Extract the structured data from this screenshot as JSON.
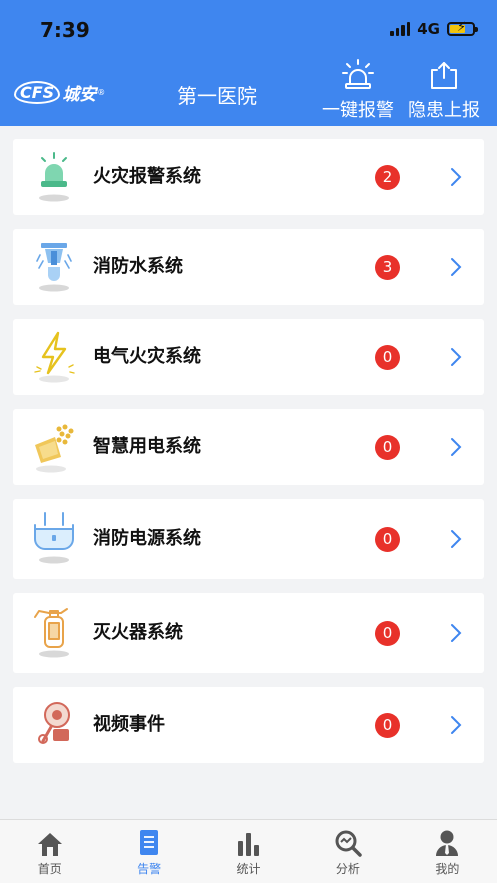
{
  "status_bar": {
    "time": "7:39",
    "network": "4G"
  },
  "header": {
    "logo_mark": "CFS",
    "logo_text": "城安",
    "logo_reg": "®",
    "title": "第一医院",
    "alarm_button_label": "一键报警",
    "hazard_button_label": "隐患上报"
  },
  "systems": [
    {
      "name": "火灾报警系统",
      "count": "2",
      "icon": "fire-alarm-beacon-icon"
    },
    {
      "name": "消防水系统",
      "count": "3",
      "icon": "sprinkler-icon"
    },
    {
      "name": "电气火灾系统",
      "count": "0",
      "icon": "lightning-icon"
    },
    {
      "name": "智慧用电系统",
      "count": "0",
      "icon": "smart-power-icon"
    },
    {
      "name": "消防电源系统",
      "count": "0",
      "icon": "power-plug-icon"
    },
    {
      "name": "灭火器系统",
      "count": "0",
      "icon": "fire-extinguisher-icon"
    },
    {
      "name": "视频事件",
      "count": "0",
      "icon": "video-camera-icon"
    }
  ],
  "tabs": [
    {
      "label": "首页",
      "icon": "home-icon"
    },
    {
      "label": "告警",
      "icon": "alarm-list-icon",
      "active": true
    },
    {
      "label": "统计",
      "icon": "bar-chart-icon"
    },
    {
      "label": "分析",
      "icon": "analysis-icon"
    },
    {
      "label": "我的",
      "icon": "user-icon"
    }
  ],
  "colors": {
    "header": "#3f86ef",
    "badge": "#e8312a",
    "active_tab": "#3f86ef"
  }
}
